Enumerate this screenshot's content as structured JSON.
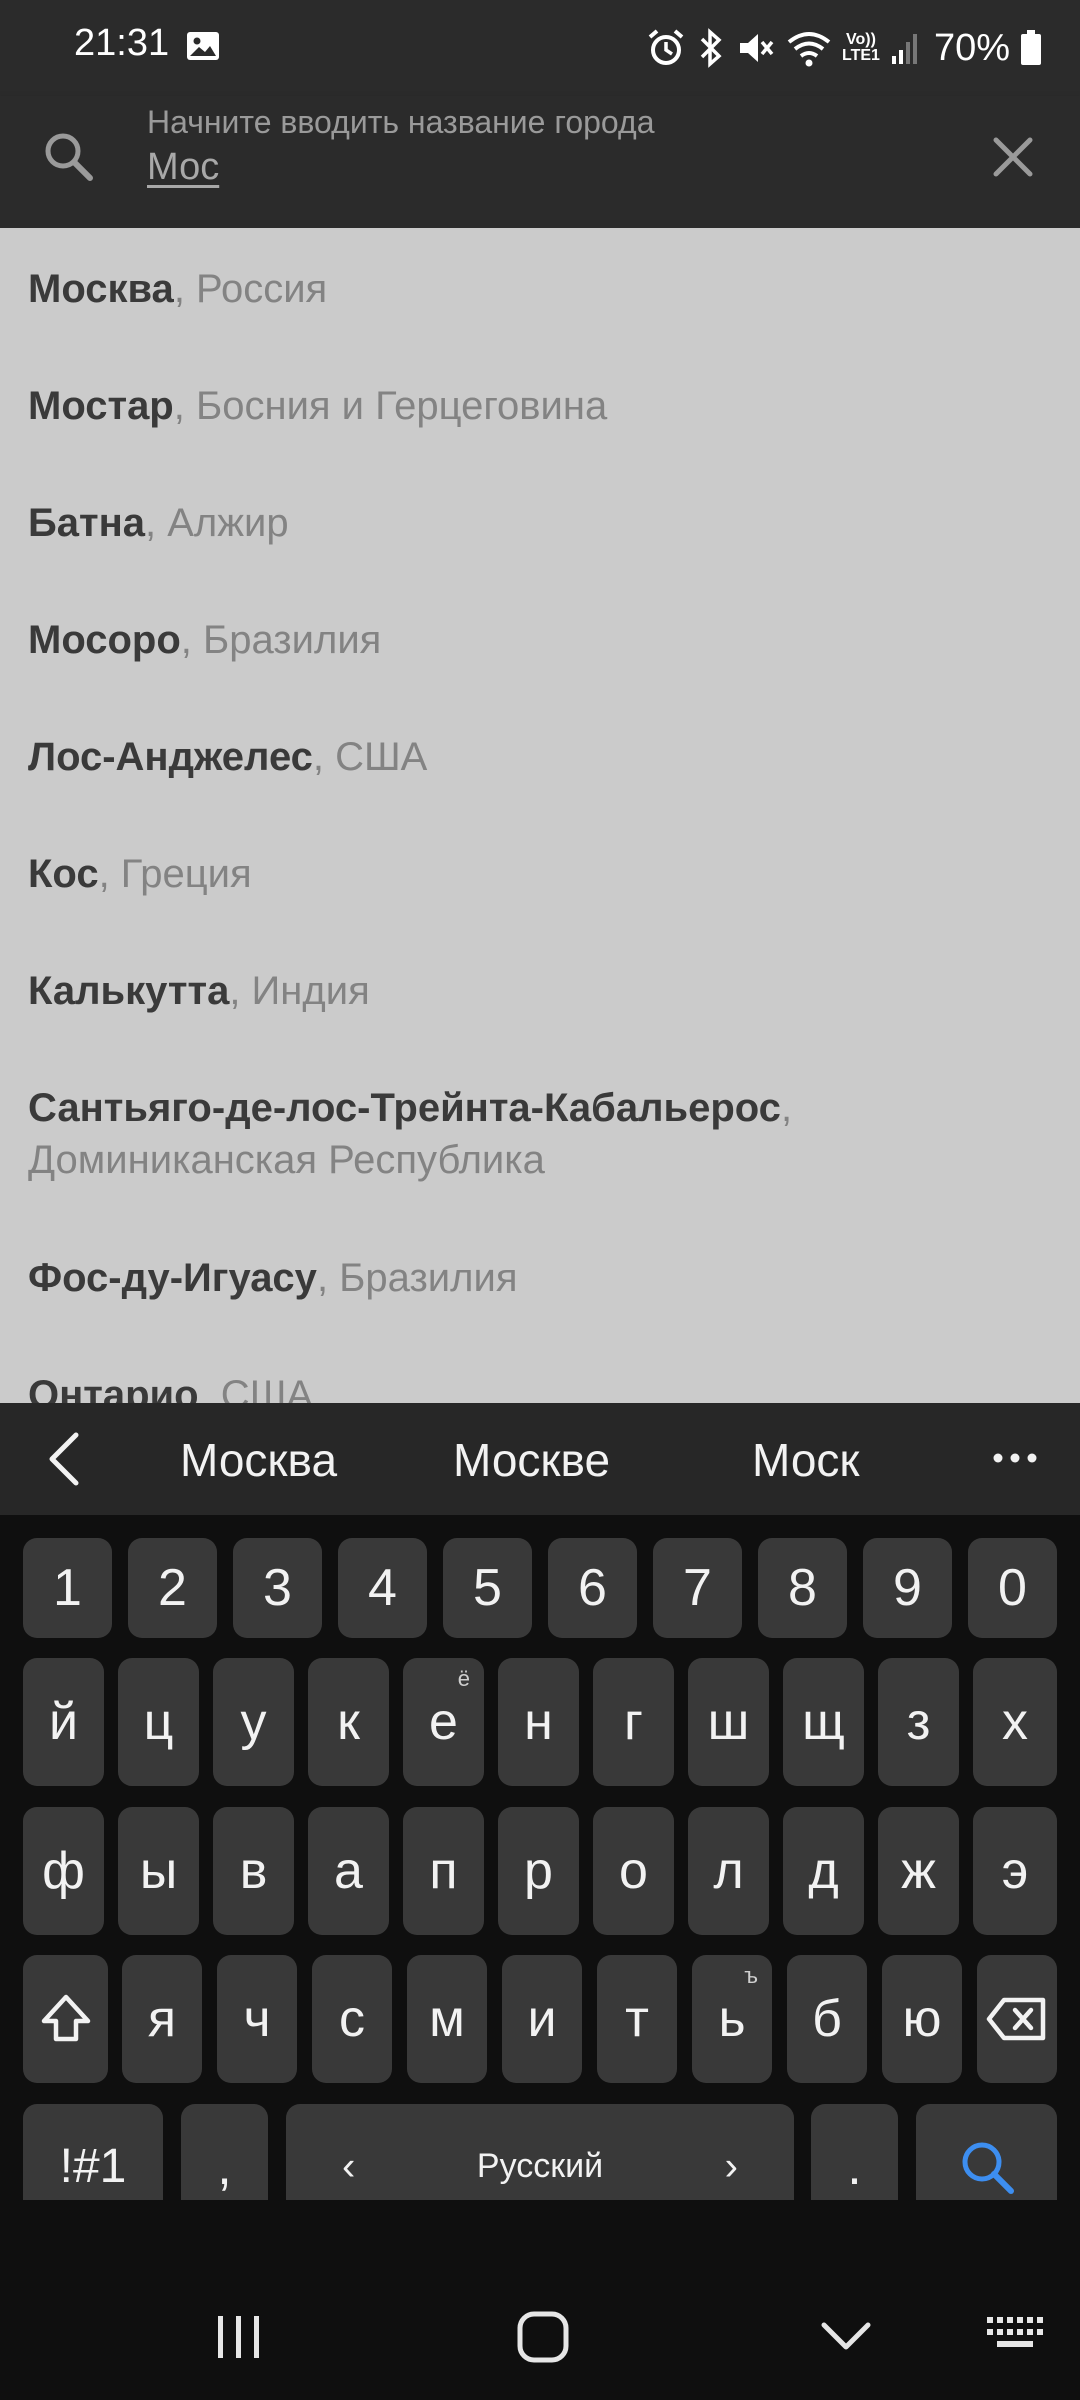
{
  "status_bar": {
    "time": "21:31",
    "battery": "70%",
    "network_label_top": "Vo))",
    "network_label_bottom": "LTE1",
    "icons": [
      "image-icon",
      "alarm-icon",
      "bluetooth-icon",
      "mute-icon",
      "wifi-icon",
      "signal-icon",
      "battery-icon"
    ]
  },
  "search": {
    "placeholder": "Начните вводить название города",
    "value": "Мос"
  },
  "results": [
    {
      "city": "Москва",
      "country": ", Россия"
    },
    {
      "city": "Мостар",
      "country": ", Босния и Герцеговина"
    },
    {
      "city": "Батна",
      "country": ", Алжир"
    },
    {
      "city": "Мосоро",
      "country": ", Бразилия"
    },
    {
      "city": "Лос-Анджелес",
      "country": ", США"
    },
    {
      "city": "Кос",
      "country": ", Греция"
    },
    {
      "city": "Калькутта",
      "country": ", Индия"
    },
    {
      "city": "Сантьяго-де-лос-Трейнта-Кабальерос",
      "country": ", Доминиканская Республика"
    },
    {
      "city": "Фос-ду-Игуасу",
      "country": ", Бразилия"
    },
    {
      "city": "Онтарио",
      "country": ", США"
    }
  ],
  "suggestions": [
    "Москва",
    "Москве",
    "Моск"
  ],
  "keyboard": {
    "numbers": [
      "1",
      "2",
      "3",
      "4",
      "5",
      "6",
      "7",
      "8",
      "9",
      "0"
    ],
    "row1": [
      "й",
      "ц",
      "у",
      "к",
      "е",
      "н",
      "г",
      "ш",
      "щ",
      "з",
      "х"
    ],
    "row1_hint_e": "ё",
    "row2": [
      "ф",
      "ы",
      "в",
      "а",
      "п",
      "р",
      "о",
      "л",
      "д",
      "ж",
      "э"
    ],
    "row3": [
      "я",
      "ч",
      "с",
      "м",
      "и",
      "т",
      "ь",
      "б",
      "ю"
    ],
    "row3_hint_soft": "ъ",
    "symbols_label": "!#1",
    "comma_label": ",",
    "space_label": "Русский",
    "period_label": ".",
    "space_left_arrow": "‹",
    "space_right_arrow": "›"
  },
  "colors": {
    "accent": "#3d8ef0",
    "key_bg": "#393939",
    "list_bg": "#cbcbcb",
    "header_bg": "#2b2b2b"
  }
}
